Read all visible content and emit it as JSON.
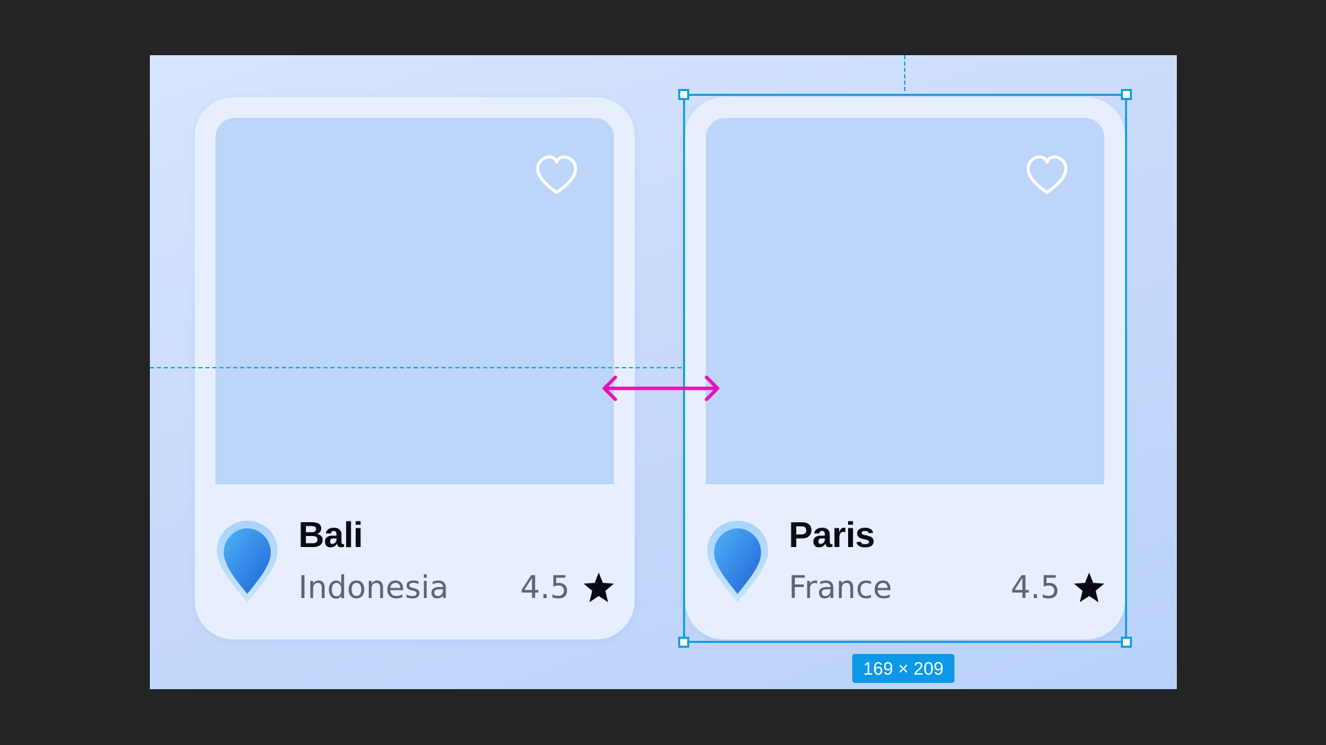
{
  "cards": [
    {
      "city": "Bali",
      "country": "Indonesia",
      "rating": "4.5"
    },
    {
      "city": "Paris",
      "country": "France",
      "rating": "4.5"
    }
  ],
  "selection": {
    "size_label": "169 × 209"
  },
  "icons": {
    "favorite": "heart-outline-icon",
    "location": "location-pin-icon",
    "rating": "star-icon",
    "spacing": "double-arrow-icon"
  },
  "colors": {
    "canvas": "#242424",
    "artboard": "#c9dbfb",
    "card": "#e7effe",
    "image_placeholder": "#bcd5f9",
    "selection": "#12a0e0",
    "spacing_arrow": "#e612b8"
  }
}
